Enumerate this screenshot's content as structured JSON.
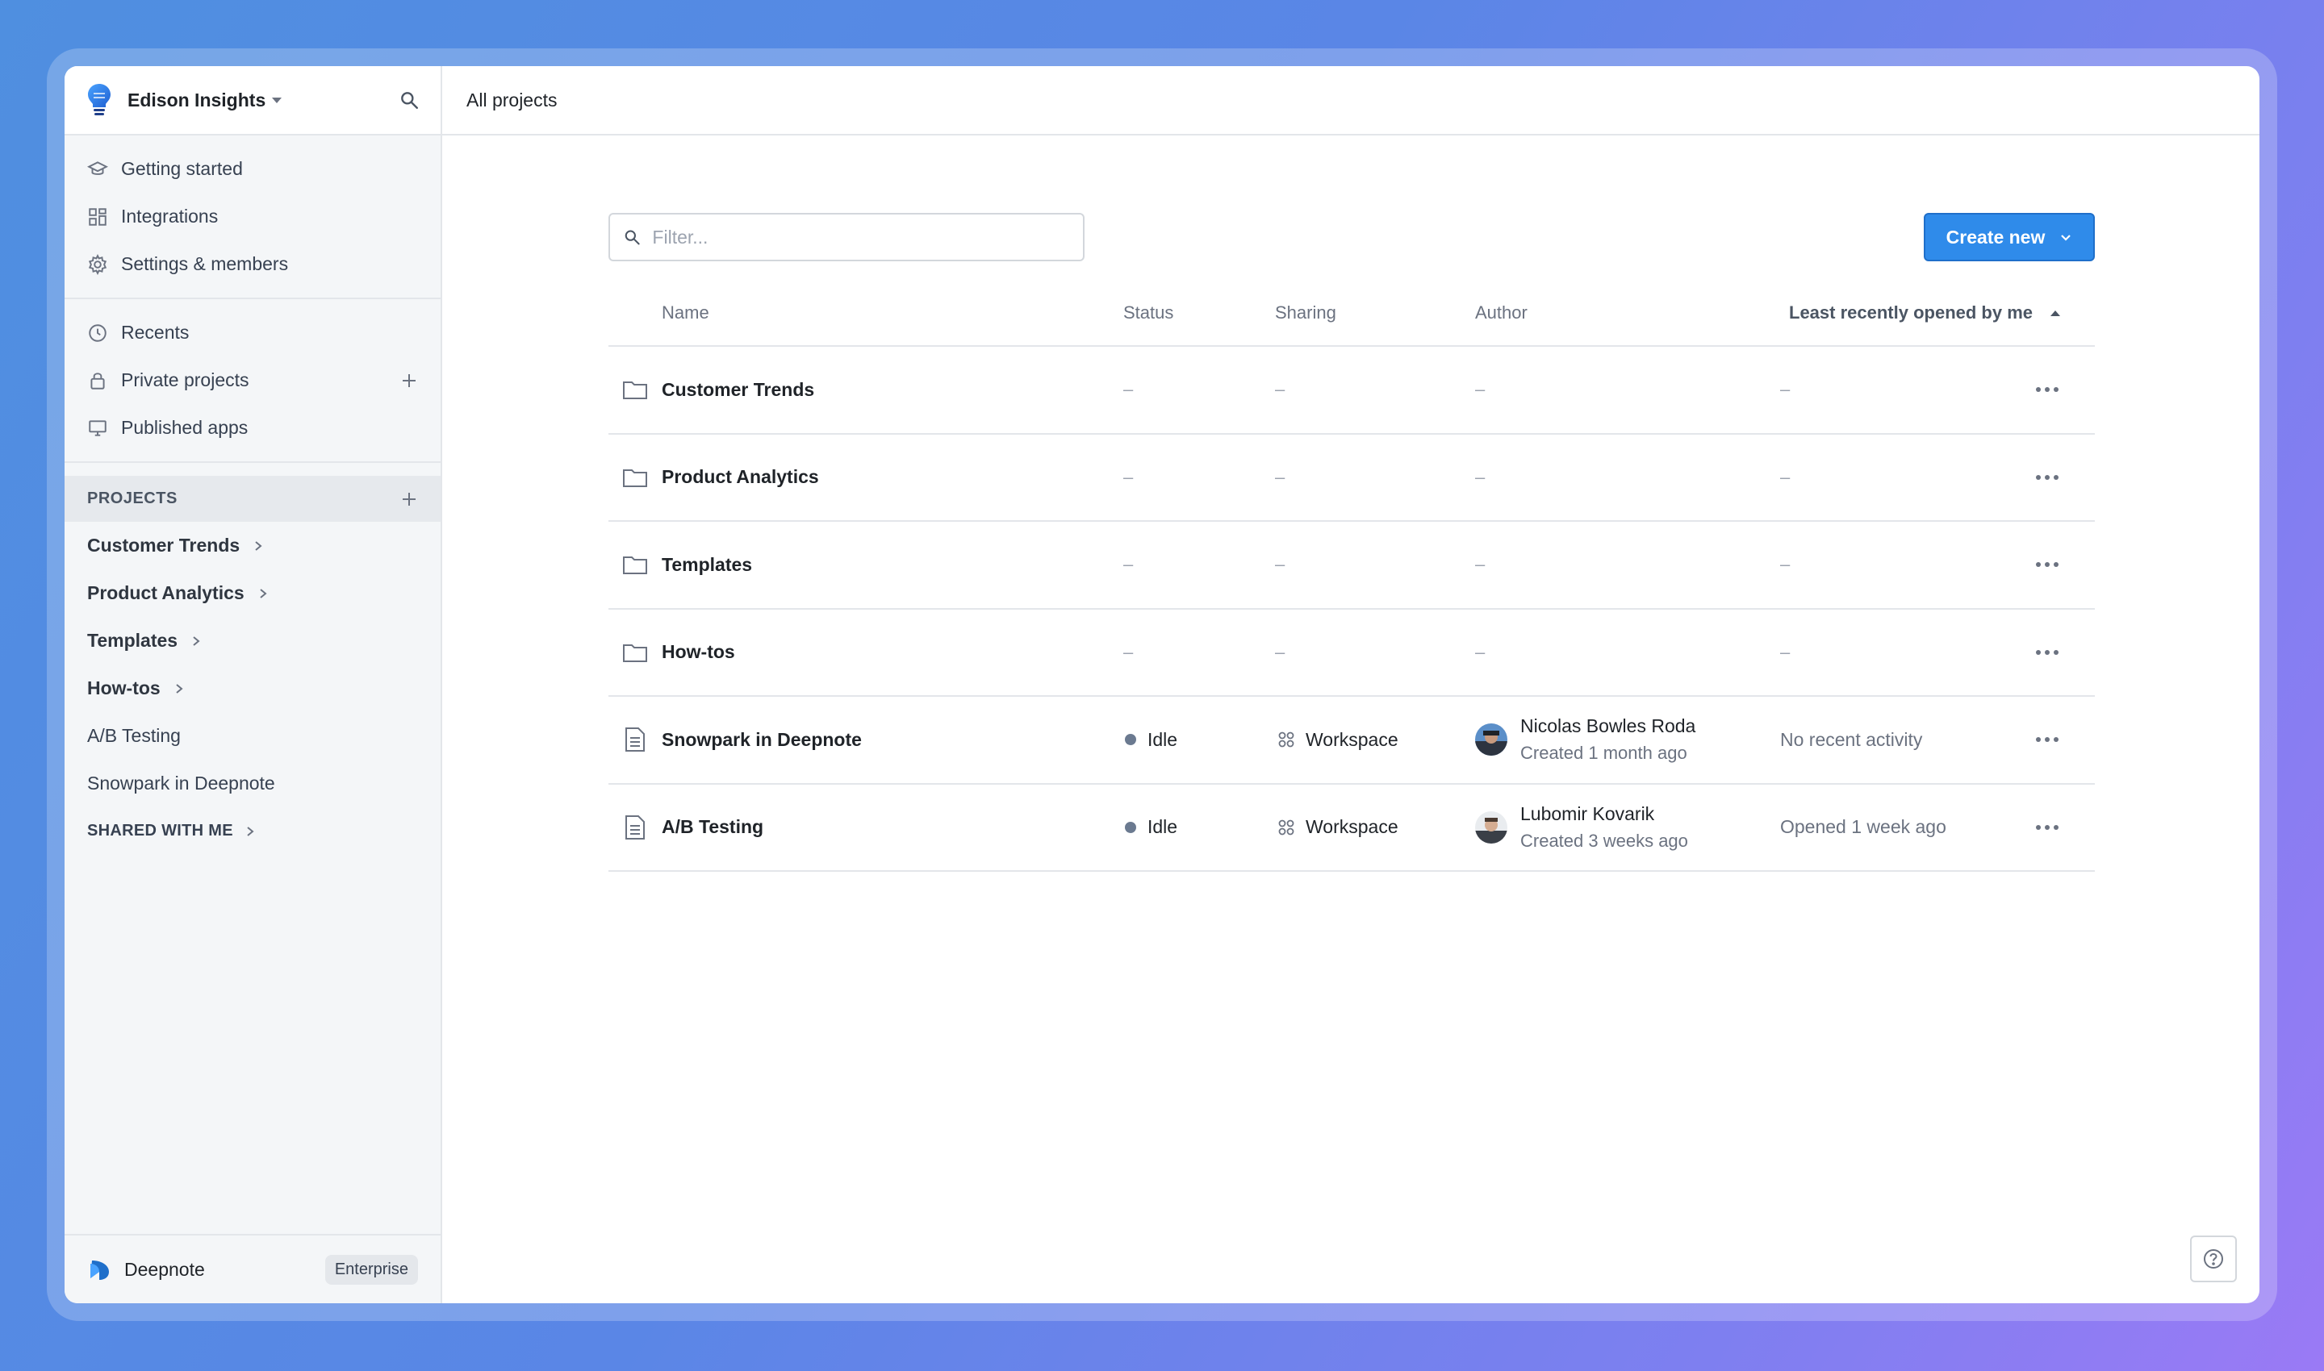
{
  "colors": {
    "accent": "#2f8bea",
    "status_idle": "#6b7a90"
  },
  "workspace": {
    "name": "Edison Insights",
    "logo_icon": "lightbulb-icon"
  },
  "sidebar": {
    "top_items": [
      {
        "label": "Getting started",
        "icon": "graduation-cap-icon"
      },
      {
        "label": "Integrations",
        "icon": "grid-icon"
      },
      {
        "label": "Settings & members",
        "icon": "gear-icon"
      }
    ],
    "mid_items": [
      {
        "label": "Recents",
        "icon": "clock-icon"
      },
      {
        "label": "Private projects",
        "icon": "lock-icon"
      },
      {
        "label": "Published apps",
        "icon": "monitor-icon"
      }
    ],
    "projects_header": "PROJECTS",
    "projects": [
      {
        "label": "Customer Trends"
      },
      {
        "label": "Product Analytics"
      },
      {
        "label": "Templates"
      },
      {
        "label": "How-tos"
      },
      {
        "label": "A/B Testing"
      },
      {
        "label": "Snowpark in Deepnote"
      }
    ],
    "shared_header": "SHARED WITH ME",
    "footer": {
      "brand": "Deepnote",
      "plan": "Enterprise"
    }
  },
  "topbar": {
    "breadcrumb": "All projects"
  },
  "toolbar": {
    "filter_placeholder": "Filter...",
    "create_label": "Create new"
  },
  "table": {
    "headers": {
      "name": "Name",
      "status": "Status",
      "sharing": "Sharing",
      "author": "Author",
      "sort": "Least recently opened by me"
    },
    "placeholder": "–",
    "folders": [
      {
        "name": "Customer Trends"
      },
      {
        "name": "Product Analytics"
      },
      {
        "name": "Templates"
      },
      {
        "name": "How-tos"
      }
    ],
    "projects": [
      {
        "name": "Snowpark in Deepnote",
        "status": "Idle",
        "sharing": "Workspace",
        "author": "Nicolas Bowles Roda",
        "created": "Created 1 month ago",
        "activity": "No recent activity"
      },
      {
        "name": "A/B Testing",
        "status": "Idle",
        "sharing": "Workspace",
        "author": "Lubomir Kovarik",
        "created": "Created 3 weeks ago",
        "activity": "Opened 1 week ago"
      }
    ]
  }
}
